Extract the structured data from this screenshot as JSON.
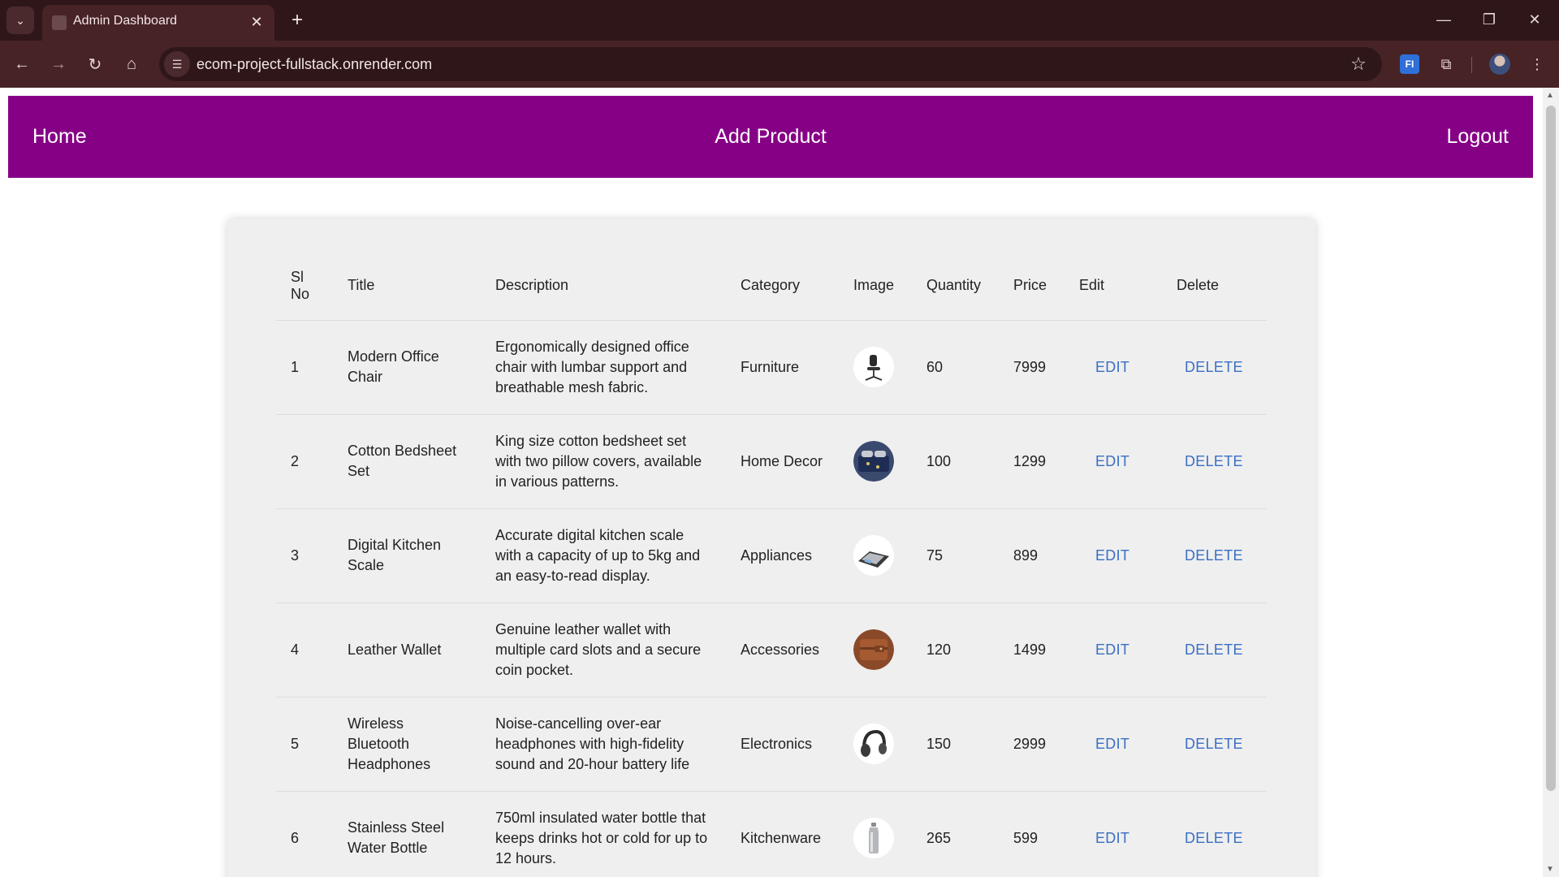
{
  "browser": {
    "tab_title": "Admin Dashboard",
    "url": "ecom-project-fullstack.onrender.com",
    "extension_label": "FI"
  },
  "navbar": {
    "home": "Home",
    "add_product": "Add Product",
    "logout": "Logout",
    "color": "#860086"
  },
  "table": {
    "headers": {
      "sl_no": "Sl No",
      "title": "Title",
      "description": "Description",
      "category": "Category",
      "image": "Image",
      "quantity": "Quantity",
      "price": "Price",
      "edit": "Edit",
      "delete": "Delete"
    },
    "rows": [
      {
        "sl": "1",
        "title": "Modern Office Chair",
        "description": "Ergonomically designed office chair with lumbar support and breathable mesh fabric.",
        "category": "Furniture",
        "image_icon": "office-chair-icon",
        "quantity": "60",
        "price": "7999",
        "edit": "EDIT",
        "delete": "DELETE"
      },
      {
        "sl": "2",
        "title": "Cotton Bedsheet Set",
        "description": "King size cotton bedsheet set with two pillow covers, available in various patterns.",
        "category": "Home Decor",
        "image_icon": "bedsheet-icon",
        "quantity": "100",
        "price": "1299",
        "edit": "EDIT",
        "delete": "DELETE"
      },
      {
        "sl": "3",
        "title": "Digital Kitchen Scale",
        "description": "Accurate digital kitchen scale with a capacity of up to 5kg and an easy-to-read display.",
        "category": "Appliances",
        "image_icon": "kitchen-scale-icon",
        "quantity": "75",
        "price": "899",
        "edit": "EDIT",
        "delete": "DELETE"
      },
      {
        "sl": "4",
        "title": "Leather Wallet",
        "description": "Genuine leather wallet with multiple card slots and a secure coin pocket.",
        "category": "Accessories",
        "image_icon": "wallet-icon",
        "quantity": "120",
        "price": "1499",
        "edit": "EDIT",
        "delete": "DELETE"
      },
      {
        "sl": "5",
        "title": "Wireless Bluetooth Headphones",
        "description": "Noise-cancelling over-ear headphones with high-fidelity sound and 20-hour battery life",
        "category": "Electronics",
        "image_icon": "headphones-icon",
        "quantity": "150",
        "price": "2999",
        "edit": "EDIT",
        "delete": "DELETE"
      },
      {
        "sl": "6",
        "title": "Stainless Steel Water Bottle",
        "description": "750ml insulated water bottle that keeps drinks hot or cold for up to 12 hours.",
        "category": "Kitchenware",
        "image_icon": "water-bottle-icon",
        "quantity": "265",
        "price": "599",
        "edit": "EDIT",
        "delete": "DELETE"
      }
    ]
  },
  "colors": {
    "action_link": "#3a6fc4",
    "card_background": "#efefef"
  }
}
